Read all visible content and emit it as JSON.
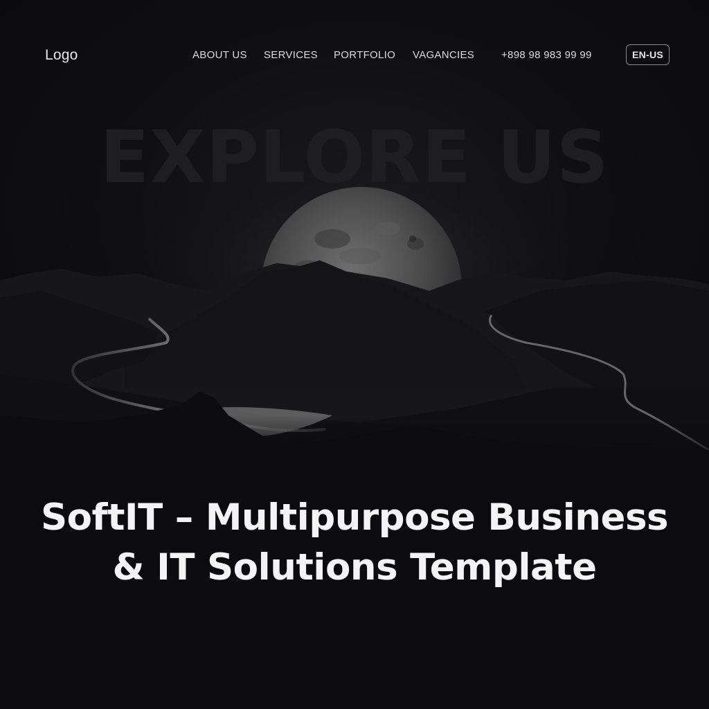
{
  "header": {
    "logo": "Logo",
    "nav": [
      {
        "label": "ABOUT US"
      },
      {
        "label": "SERVICES"
      },
      {
        "label": "PORTFOLIO"
      },
      {
        "label": "VAGANCIES"
      }
    ],
    "phone": "+898 98 983 99 99",
    "language": "EN-US"
  },
  "hero": {
    "watermark": "EXPLORE US",
    "image_subject": "moon rising over dark mountains and winding river"
  },
  "headline": {
    "line1": "SoftIT – Multipurpose Business",
    "line2": "& IT Solutions Template"
  },
  "colors": {
    "background": "#0c0c0e",
    "text": "#f4f4f4",
    "watermark": "#1e1e20"
  }
}
